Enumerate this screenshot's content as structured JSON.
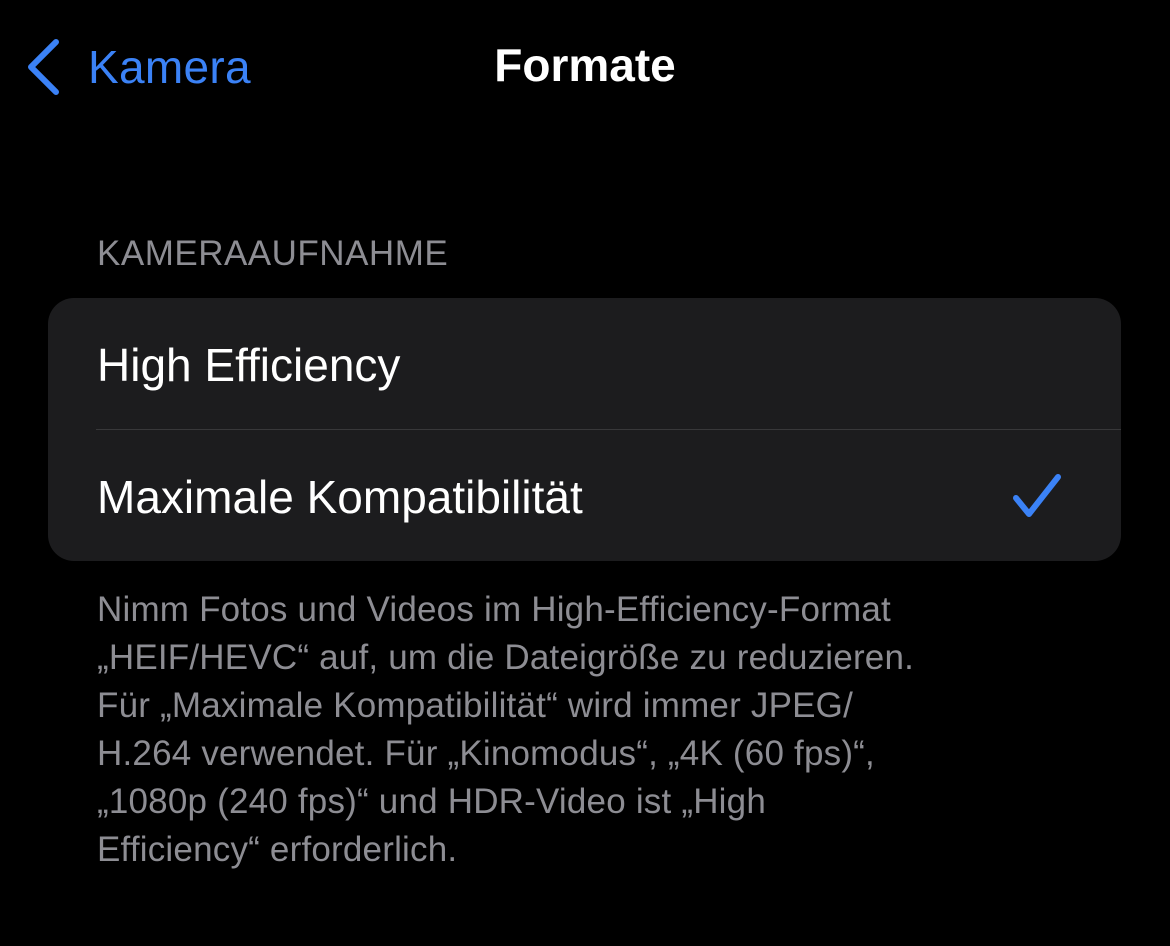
{
  "nav": {
    "back_label": "Kamera",
    "title": "Formate"
  },
  "section": {
    "header": "KAMERAAUFNAHME",
    "options": [
      {
        "label": "High Efficiency",
        "selected": false
      },
      {
        "label": "Maximale Kompatibilität",
        "selected": true
      }
    ],
    "footer_lines": [
      "Nimm Fotos und Videos im High-Efficiency-Format",
      "„HEIF/HEVC“ auf, um die Dateigröße zu reduzieren.",
      "Für „Maximale Kompatibilität“ wird immer JPEG/",
      "H.264 verwendet. Für „Kinomodus“, „4K (60 fps)“,",
      "„1080p (240 fps)“ und HDR-Video ist „High",
      "Efficiency“ erforderlich."
    ]
  },
  "icons": {
    "back": "chevron-left-icon",
    "selected": "checkmark-icon"
  },
  "colors": {
    "background": "#000000",
    "accent": "#3b82f6",
    "cell_background": "#1c1c1e",
    "secondary_text": "#8d8d93",
    "separator": "#38383a"
  }
}
